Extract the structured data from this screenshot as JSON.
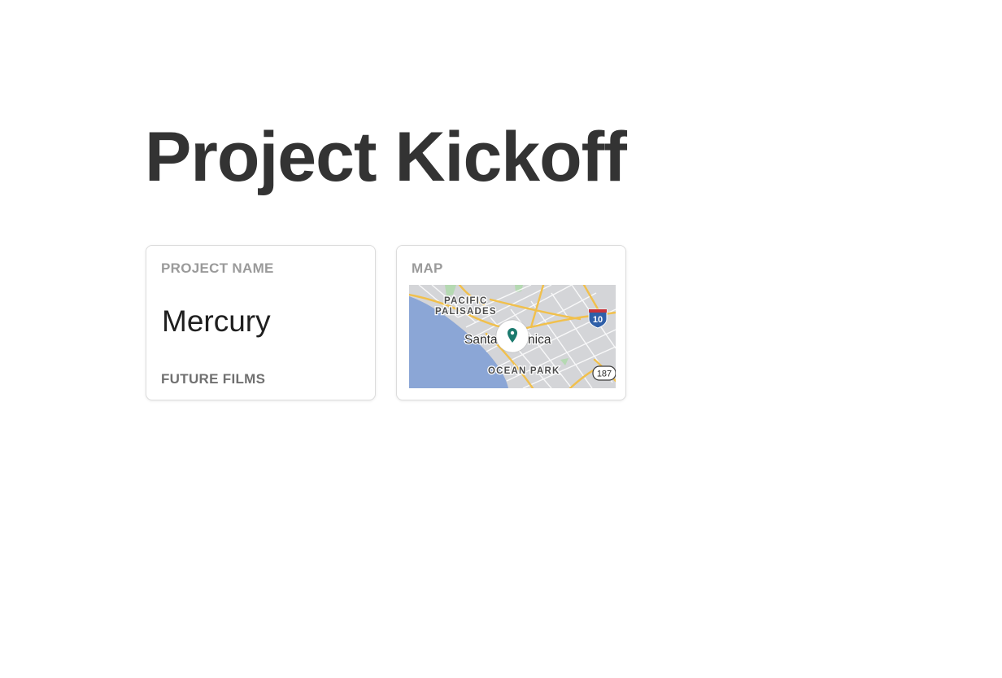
{
  "page": {
    "title": "Project Kickoff"
  },
  "project_card": {
    "label": "PROJECT NAME",
    "value": "Mercury",
    "subtitle": "FUTURE FILMS"
  },
  "map_card": {
    "label": "MAP",
    "map": {
      "labels": {
        "district_1_line_1": "PACIFIC",
        "district_1_line_2": "PALISADES",
        "city_part_1": "Santa",
        "city_part_2": "nica",
        "district_2": "OCEAN PARK"
      },
      "shields": {
        "interstate": "10",
        "state_route": "187"
      },
      "pin_icon": "location-pin-icon",
      "colors": {
        "ocean": "#8ba6d6",
        "land": "#d4d5d8",
        "road": "#f1c04c",
        "pin": "#1b7a6e",
        "park": "#b5d9b2"
      }
    }
  }
}
